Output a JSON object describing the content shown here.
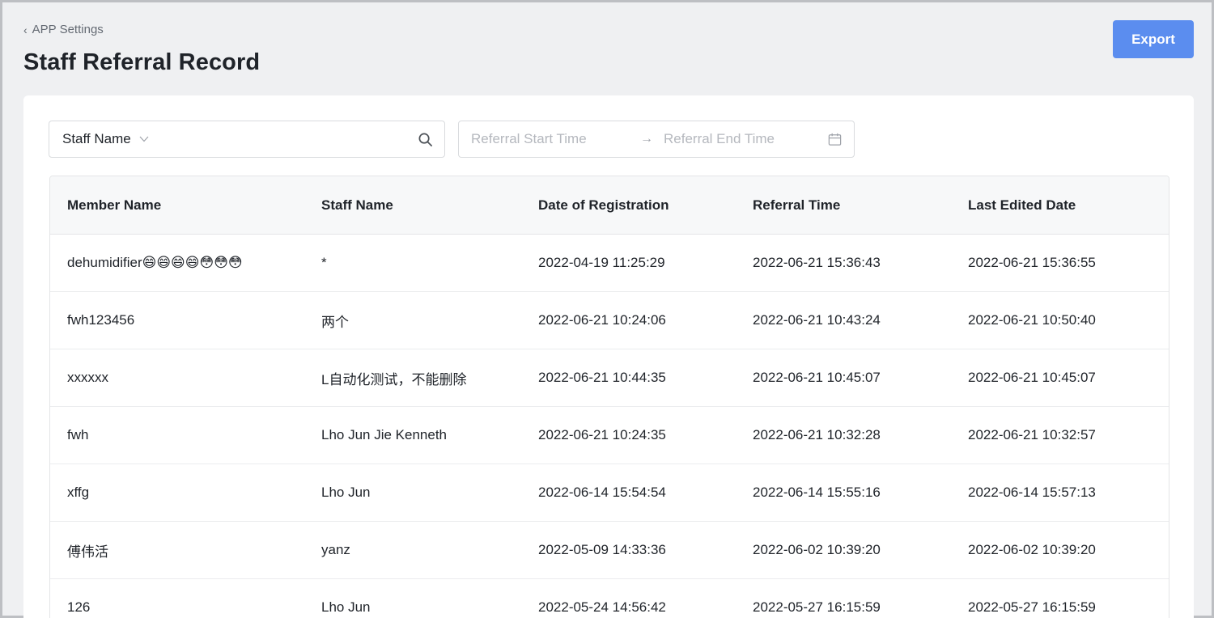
{
  "header": {
    "back_label": "APP Settings",
    "back_icon": "chevron-left-icon",
    "title": "Staff Referral Record",
    "export_label": "Export",
    "accent_color": "#5b8def"
  },
  "filters": {
    "staff_select_label": "Staff Name",
    "start_placeholder": "Referral Start Time",
    "end_placeholder": "Referral End Time",
    "arrow": "→"
  },
  "table": {
    "columns": [
      "Member Name",
      "Staff Name",
      "Date of Registration",
      "Referral Time",
      "Last Edited Date"
    ],
    "rows": [
      [
        "dehumidifier😄😄😄😄😳😳😳",
        "*",
        "2022-04-19 11:25:29",
        "2022-06-21 15:36:43",
        "2022-06-21 15:36:55"
      ],
      [
        "fwh123456",
        "两个",
        "2022-06-21 10:24:06",
        "2022-06-21 10:43:24",
        "2022-06-21 10:50:40"
      ],
      [
        "xxxxxx",
        "L自动化测试，不能删除",
        "2022-06-21 10:44:35",
        "2022-06-21 10:45:07",
        "2022-06-21 10:45:07"
      ],
      [
        "fwh",
        "Lho Jun Jie Kenneth",
        "2022-06-21 10:24:35",
        "2022-06-21 10:32:28",
        "2022-06-21 10:32:57"
      ],
      [
        "xffg",
        "Lho Jun",
        "2022-06-14 15:54:54",
        "2022-06-14 15:55:16",
        "2022-06-14 15:57:13"
      ],
      [
        "傅伟活",
        "yanz",
        "2022-05-09 14:33:36",
        "2022-06-02 10:39:20",
        "2022-06-02 10:39:20"
      ],
      [
        "126",
        "Lho Jun",
        "2022-05-24 14:56:42",
        "2022-05-27 16:15:59",
        "2022-05-27 16:15:59"
      ]
    ]
  }
}
